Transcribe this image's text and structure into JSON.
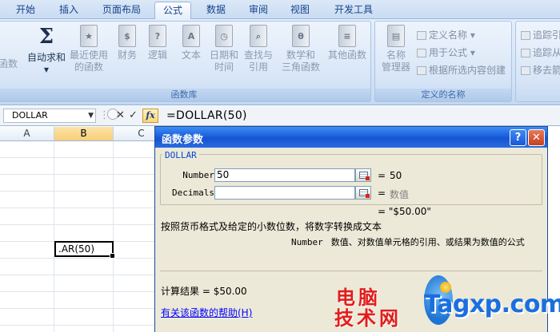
{
  "tabs": [
    {
      "label": "开始",
      "active": false
    },
    {
      "label": "插入",
      "active": false
    },
    {
      "label": "页面布局",
      "active": false
    },
    {
      "label": "公式",
      "active": true
    },
    {
      "label": "数据",
      "active": false
    },
    {
      "label": "审阅",
      "active": false
    },
    {
      "label": "视图",
      "active": false
    },
    {
      "label": "开发工具",
      "active": false
    }
  ],
  "ribbon": {
    "insert_fn_partial": "函数",
    "library": {
      "label": "函数库",
      "autosum": "自动求和",
      "recent_1": "最近使用",
      "recent_2": "的函数",
      "financial": "财务",
      "logical": "逻辑",
      "text": "文本",
      "datetime_1": "日期和",
      "datetime_2": "时间",
      "lookup_1": "查找与",
      "lookup_2": "引用",
      "math_1": "数学和",
      "math_2": "三角函数",
      "more": "其他函数"
    },
    "names": {
      "label": "定义的名称",
      "manager_1": "名称",
      "manager_2": "管理器",
      "define": "定义名称",
      "use": "用于公式",
      "create": "根据所选内容创建"
    },
    "audit": {
      "trace_prec": "追踪引",
      "trace_dep": "追踪从",
      "remove": "移去箭"
    }
  },
  "formula_bar": {
    "name_box": "DOLLAR",
    "cancel": "✕",
    "enter": "✓",
    "fx": "fx",
    "formula": "=DOLLAR(50)"
  },
  "columns": [
    "A",
    "B",
    "C"
  ],
  "active_cell_text": ".AR(50)",
  "dialog": {
    "title": "函数参数",
    "help_btn": "?",
    "close_btn": "✕",
    "function_name": "DOLLAR",
    "args": [
      {
        "label": "Number",
        "value": "50",
        "result": "50",
        "hint": false
      },
      {
        "label": "Decimals",
        "value": "",
        "result": "数值",
        "hint": true
      }
    ],
    "eq": "=",
    "formula_result": "= \"$50.00\"",
    "description": "按照货币格式及给定的小数位数，将数字转换成文本",
    "param_name": "Number",
    "param_desc": "数值、对数值单元格的引用、或结果为数值的公式",
    "calc_label": "计算结果 = ",
    "calc_value": "$50.00",
    "help_link": "有关该函数的帮助(H)"
  },
  "watermark": {
    "cn_1": "电脑",
    "cn_2": "技术网",
    "en": "Tagxp.com"
  }
}
